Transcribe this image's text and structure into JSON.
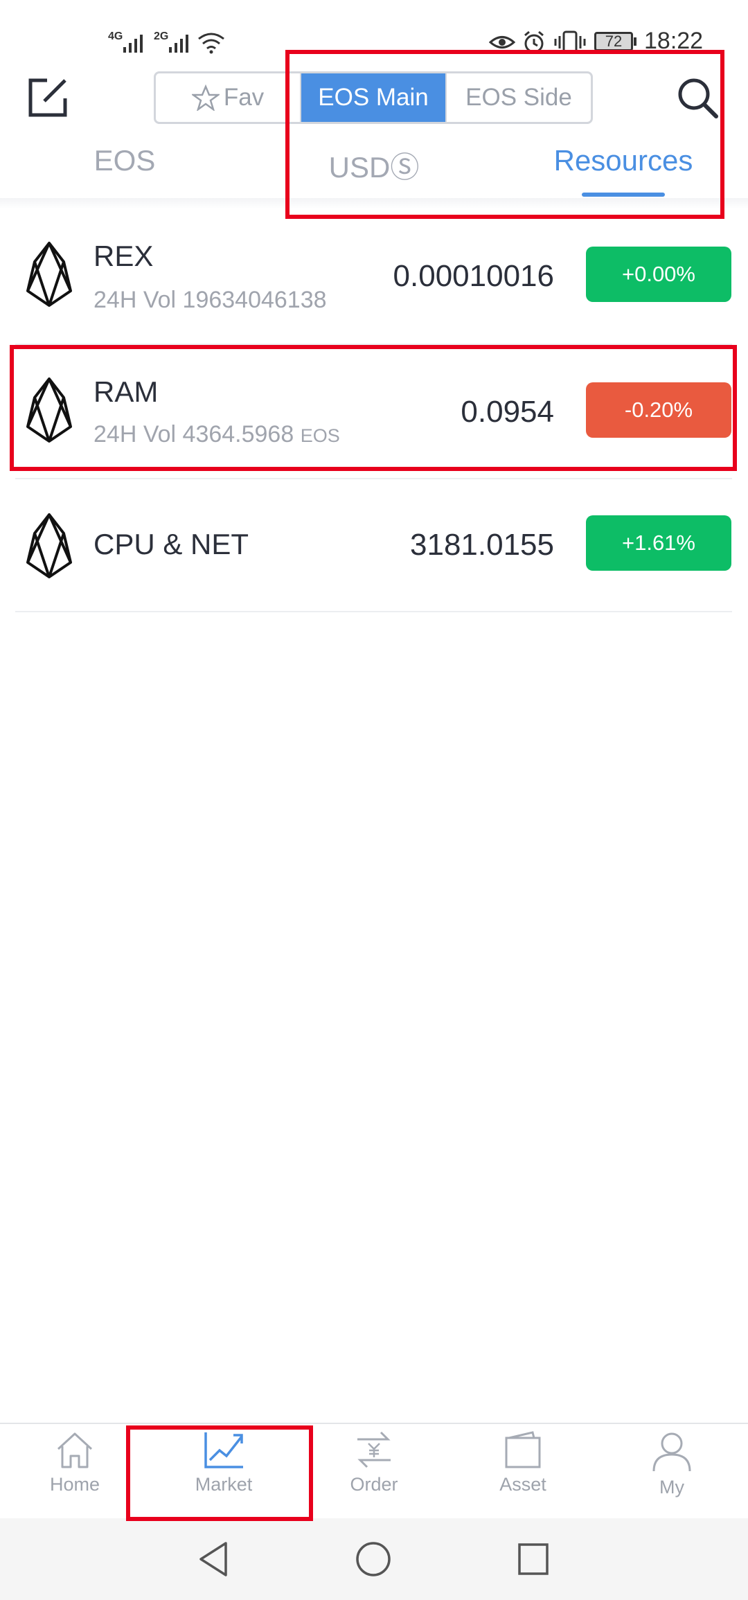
{
  "status_bar": {
    "network_1": "4G",
    "network_2": "2G",
    "battery": "72",
    "time": "18:22"
  },
  "header": {
    "segments": [
      {
        "label": "Fav",
        "active": false
      },
      {
        "label": "EOS Main",
        "active": true
      },
      {
        "label": "EOS Side",
        "active": false
      }
    ],
    "tabs": [
      {
        "label": "EOS",
        "active": false
      },
      {
        "label": "USDⓈ",
        "active": false
      },
      {
        "label": "Resources",
        "active": true
      }
    ]
  },
  "markets": [
    {
      "name": "REX",
      "vol_prefix": "24H Vol ",
      "vol_value": "19634046138",
      "vol_unit": "",
      "price": "0.00010016",
      "change": "+0.00%",
      "direction": "up"
    },
    {
      "name": "RAM",
      "vol_prefix": "24H Vol ",
      "vol_value": "4364.5968",
      "vol_unit": "EOS",
      "price": "0.0954",
      "change": "-0.20%",
      "direction": "down"
    },
    {
      "name": "CPU & NET",
      "vol_prefix": "",
      "vol_value": "",
      "vol_unit": "",
      "price": "3181.0155",
      "change": "+1.61%",
      "direction": "up"
    }
  ],
  "bottom_nav": [
    {
      "label": "Home",
      "icon": "home-icon",
      "active": false
    },
    {
      "label": "Market",
      "icon": "chart-icon",
      "active": true
    },
    {
      "label": "Order",
      "icon": "exchange-icon",
      "active": false
    },
    {
      "label": "Asset",
      "icon": "wallet-icon",
      "active": false
    },
    {
      "label": "My",
      "icon": "user-icon",
      "active": false
    }
  ],
  "colors": {
    "accent": "#4a8fe2",
    "up": "#0dbd66",
    "down": "#e95a3f",
    "annotation": "#e8001c"
  }
}
